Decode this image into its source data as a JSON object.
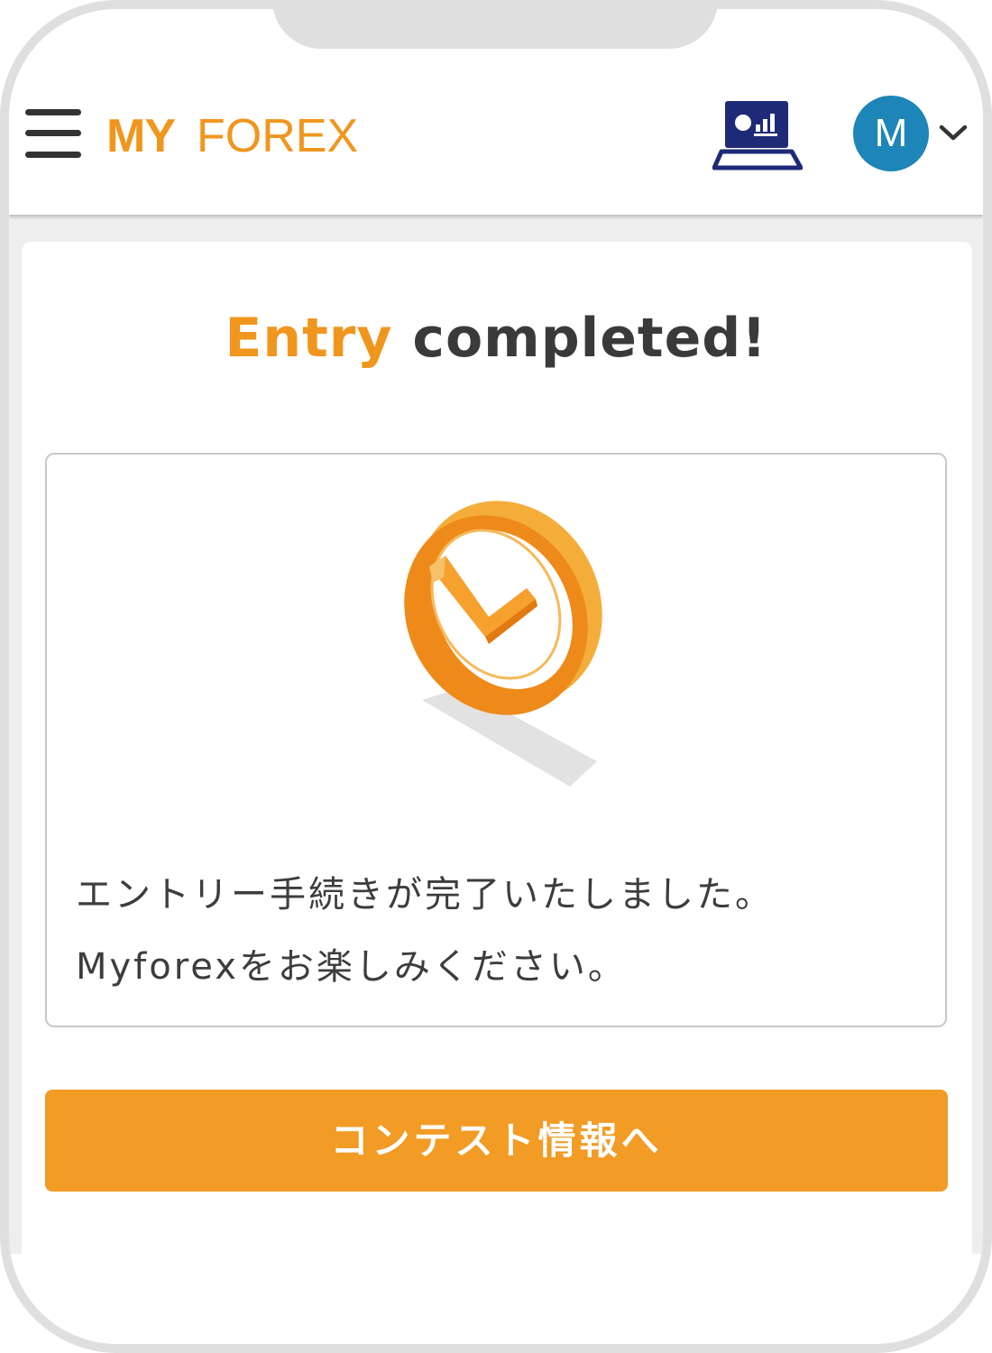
{
  "header": {
    "menu_icon": "hamburger-menu-icon",
    "logo_text": "MYFOREX",
    "logo_prefix": "MY",
    "logo_suffix": "FOREX",
    "trading_icon": "pc-chart-icon",
    "avatar_initial": "M",
    "dropdown_icon": "chevron-down-icon"
  },
  "main": {
    "title_accent": "Entry",
    "title_rest": "completed!",
    "illustration_icon": "check-circle-icon",
    "message_lines": [
      "エントリー手続きが完了いたしました。",
      "Myforexをお楽しみください。"
    ],
    "cta_label": "コンテスト情報へ"
  },
  "colors": {
    "accent": "#f0961e",
    "button": "#f29b25",
    "avatar": "#1e85b8",
    "text": "#3a3a3a",
    "icon_navy": "#1e2a78"
  }
}
